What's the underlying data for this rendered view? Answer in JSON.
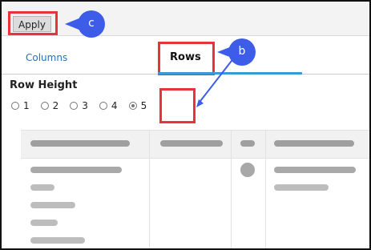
{
  "toolbar": {
    "apply_label": "Apply"
  },
  "callouts": {
    "c": "c",
    "b": "b"
  },
  "tabs": {
    "columns_label": "Columns",
    "rows_label": "Rows"
  },
  "row_height": {
    "heading": "Row Height",
    "options": [
      "1",
      "2",
      "3",
      "4",
      "5"
    ],
    "selected": "5"
  },
  "colors": {
    "highlight": "#e8323c",
    "callout": "#3d5ce8",
    "tab_active": "#3a9ad9",
    "tab_link": "#2a6ebb"
  }
}
